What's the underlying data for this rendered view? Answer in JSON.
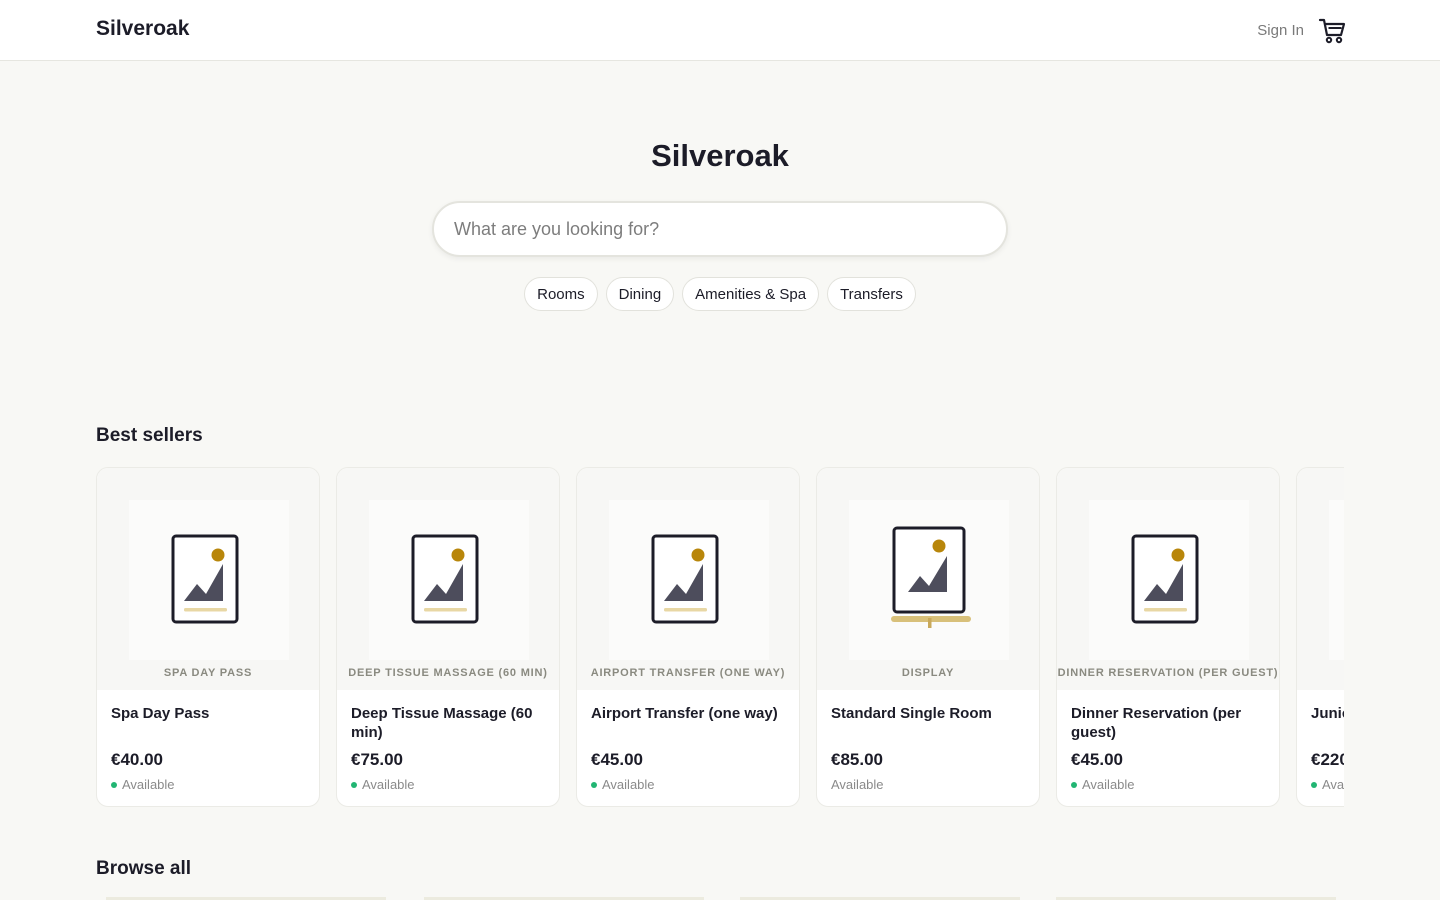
{
  "header": {
    "logo": "Silveroak",
    "sign_in": "Sign In",
    "cart_icon": "cart-icon"
  },
  "hero": {
    "title": "Silveroak",
    "search_placeholder": "What are you looking for?",
    "chips": [
      "Rooms",
      "Dining",
      "Amenities & Spa",
      "Transfers"
    ]
  },
  "best_sellers": {
    "title": "Best sellers",
    "products": [
      {
        "category": "SPA DAY PASS",
        "name": "Spa Day Pass",
        "price": "€40.00",
        "status": "Available",
        "status_dot": true,
        "image_icon": "image-placeholder-icon"
      },
      {
        "category": "DEEP TISSUE MASSAGE (60 MIN)",
        "name": "Deep Tissue Massage (60 min)",
        "price": "€75.00",
        "status": "Available",
        "status_dot": true,
        "image_icon": "image-placeholder-icon"
      },
      {
        "category": "AIRPORT TRANSFER (ONE WAY)",
        "name": "Airport Transfer (one way)",
        "price": "€45.00",
        "status": "Available",
        "status_dot": true,
        "image_icon": "image-placeholder-icon"
      },
      {
        "category": "DISPLAY",
        "name": "Standard Single Room",
        "price": "€85.00",
        "status": "Available",
        "status_dot": false,
        "image_icon": "display-placeholder-icon"
      },
      {
        "category": "DINNER RESERVATION (PER GUEST)",
        "name": "Dinner Reservation (per guest)",
        "price": "€45.00",
        "status": "Available",
        "status_dot": true,
        "image_icon": "image-placeholder-icon"
      },
      {
        "category": "",
        "name": "Junic",
        "price": "€220",
        "status": "Avai",
        "status_dot": true,
        "image_icon": "image-placeholder-icon"
      }
    ]
  },
  "browse_all": {
    "title": "Browse all"
  },
  "colors": {
    "accent_gold": "#b8860b",
    "available_green": "#22b573",
    "ink": "#1c1c28"
  }
}
